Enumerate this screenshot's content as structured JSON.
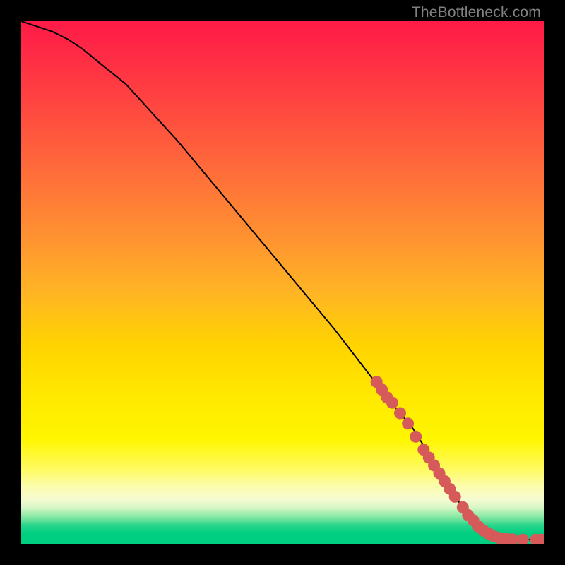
{
  "watermark": "TheBottleneck.com",
  "chart_data": {
    "type": "line",
    "title": "",
    "xlabel": "",
    "ylabel": "",
    "xlim": [
      0,
      100
    ],
    "ylim": [
      0,
      100
    ],
    "grid": false,
    "legend": false,
    "series": [
      {
        "name": "curve",
        "style": "line",
        "color": "#000000",
        "x": [
          0,
          3,
          6,
          9,
          12,
          15,
          20,
          30,
          40,
          50,
          60,
          70,
          75,
          80,
          83,
          86,
          89,
          92,
          95,
          100
        ],
        "y": [
          100,
          99,
          98,
          96.5,
          94.5,
          92,
          88,
          77,
          65,
          53,
          41,
          28,
          22,
          14,
          9,
          5,
          2.3,
          1.1,
          0.8,
          0.8
        ]
      },
      {
        "name": "highlight-points",
        "style": "marker",
        "color": "#d65a5a",
        "points": [
          {
            "x": 68,
            "y": 31
          },
          {
            "x": 69,
            "y": 29.5
          },
          {
            "x": 70,
            "y": 28
          },
          {
            "x": 71,
            "y": 27
          },
          {
            "x": 72.5,
            "y": 25
          },
          {
            "x": 74,
            "y": 23
          },
          {
            "x": 75.5,
            "y": 20.5
          },
          {
            "x": 77,
            "y": 18
          },
          {
            "x": 78,
            "y": 16.5
          },
          {
            "x": 79,
            "y": 15
          },
          {
            "x": 80,
            "y": 13.5
          },
          {
            "x": 81,
            "y": 12
          },
          {
            "x": 82,
            "y": 10.5
          },
          {
            "x": 83,
            "y": 9
          },
          {
            "x": 84.5,
            "y": 7
          },
          {
            "x": 85.5,
            "y": 5.5
          },
          {
            "x": 86.5,
            "y": 4.5
          },
          {
            "x": 87.5,
            "y": 3.3
          },
          {
            "x": 88.5,
            "y": 2.5
          },
          {
            "x": 89.5,
            "y": 1.9
          },
          {
            "x": 90.5,
            "y": 1.4
          },
          {
            "x": 91.5,
            "y": 1.1
          },
          {
            "x": 92.3,
            "y": 1.0
          },
          {
            "x": 93.0,
            "y": 0.9
          },
          {
            "x": 94.0,
            "y": 0.85
          },
          {
            "x": 96.0,
            "y": 0.8
          },
          {
            "x": 98.5,
            "y": 0.8
          },
          {
            "x": 99.5,
            "y": 0.8
          }
        ]
      }
    ]
  }
}
